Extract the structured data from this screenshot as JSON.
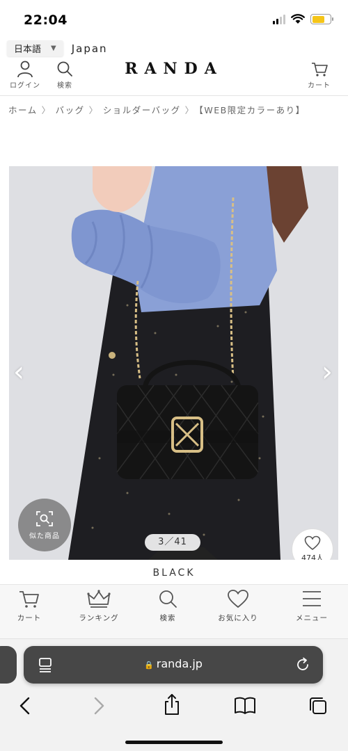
{
  "status_bar": {
    "time": "22:04",
    "battery_level": 0.7,
    "battery_color": "#f5c518"
  },
  "language": {
    "selected": "日本語",
    "region": "Japan"
  },
  "header": {
    "login_label": "ログイン",
    "search_label": "検索",
    "logo": "RANDA",
    "cart_label": "カート"
  },
  "breadcrumb": [
    "ホーム",
    "バッグ",
    "ショルダーバッグ",
    "【WEB限定カラーあり】"
  ],
  "product": {
    "similar_label": "似た商品",
    "image_counter": "3／41",
    "likes": "474人",
    "color_name": "BLACK",
    "colors": {
      "bag": "#141414",
      "shirt": "#8aa0d6",
      "skirt": "#1e1e22",
      "gold": "#d8bf86",
      "background": "#dedfe3"
    }
  },
  "bottom_nav": [
    {
      "label": "カート",
      "icon": "cart-icon"
    },
    {
      "label": "ランキング",
      "icon": "crown-icon"
    },
    {
      "label": "検索",
      "icon": "search-icon"
    },
    {
      "label": "お気に入り",
      "icon": "heart-icon"
    },
    {
      "label": "メニュー",
      "icon": "menu-icon"
    }
  ],
  "browser": {
    "url": "randa.jp"
  }
}
